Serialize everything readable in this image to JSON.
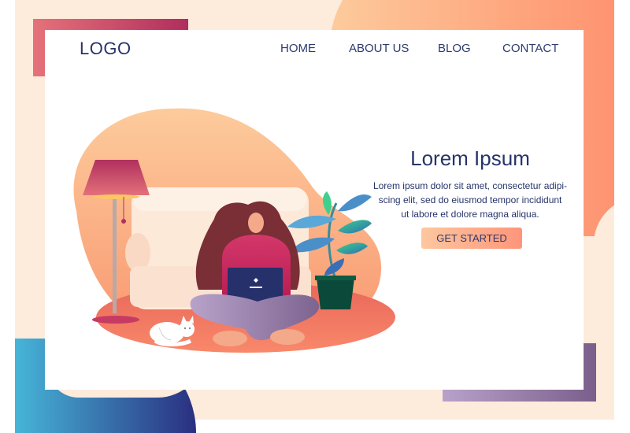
{
  "header": {
    "logo": "LOGO",
    "nav": [
      {
        "label": "HOME"
      },
      {
        "label": "ABOUT US"
      },
      {
        "label": "BLOG"
      },
      {
        "label": "CONTACT"
      }
    ]
  },
  "hero": {
    "title": "Lorem Ipsum",
    "text_lines": [
      "Lorem ipsum dolor sit amet, consectetur adipi-",
      "scing elit, sed do eiusmod tempor incididunt",
      "ut labore et dolore magna aliqua."
    ],
    "cta_label": "GET STARTED"
  },
  "illustration": {
    "description": "Woman sitting cross-legged with laptop in front of sofa, with floor lamp, potted plant and cat",
    "laptop_icon": "heart-icon"
  },
  "colors": {
    "text_primary": "#27346a",
    "background_cream": "#fdebdc",
    "accent_orange": "#fe957a",
    "accent_pink": "#b02e5d",
    "accent_blue": "#2a2f80",
    "accent_purple": "#7a5e8b"
  }
}
